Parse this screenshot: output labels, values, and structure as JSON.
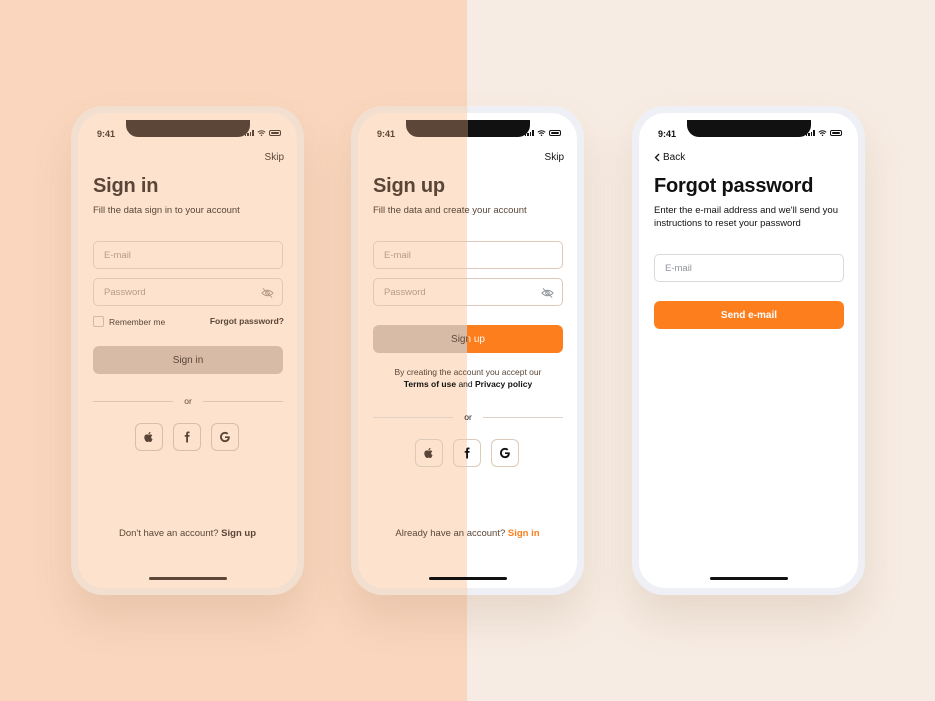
{
  "status": {
    "time": "9:41"
  },
  "signin": {
    "skip": "Skip",
    "title": "Sign in",
    "subtitle": "Fill the data sign in to your account",
    "email_placeholder": "E-mail",
    "password_placeholder": "Password",
    "remember": "Remember me",
    "forgot": "Forgot password?",
    "button": "Sign in",
    "or": "or",
    "footer_prefix": "Don't have an account?",
    "footer_link": "Sign up"
  },
  "signup": {
    "skip": "Skip",
    "title": "Sign up",
    "subtitle": "Fill the data and create your account",
    "email_placeholder": "E-mail",
    "password_placeholder": "Password",
    "button": "Sign up",
    "terms_line1": "By creating the account you accept our",
    "terms_link1": "Terms of use",
    "terms_and": "and",
    "terms_link2": "Privacy policy",
    "or": "or",
    "footer_prefix": "Already have an account?",
    "footer_link": "Sign in"
  },
  "forgot": {
    "back": "Back",
    "title": "Forgot password",
    "subtitle": "Enter the e-mail address and we'll send you instructions to reset your password",
    "email_placeholder": "E-mail",
    "button": "Send e-mail"
  },
  "icons": [
    "apple-icon",
    "facebook-icon",
    "google-icon",
    "eye-off-icon",
    "chevron-left-icon"
  ],
  "colors": {
    "accent": "#fd7e1d",
    "peach_bg": "#fde3cd",
    "muted_button": "#d8bba6"
  }
}
